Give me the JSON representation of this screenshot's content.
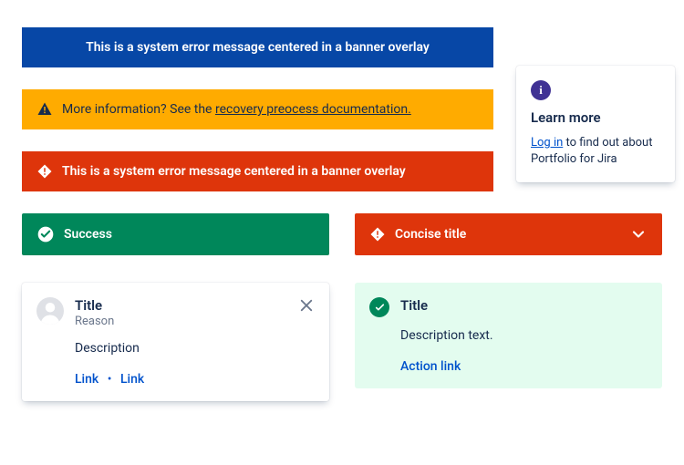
{
  "banners": {
    "blue": {
      "text": "This is a system error message centered in a banner overlay"
    },
    "orange": {
      "prefix": "More information? See the ",
      "link_text": "recovery preocess documentation."
    },
    "red": {
      "text": "This is a system error message centered in a banner overlay"
    }
  },
  "info_card": {
    "title": "Learn more",
    "login_link": "Log in",
    "body_suffix": " to find out about Portfolio for Jira"
  },
  "bar_success": {
    "label": "Success"
  },
  "bar_concise": {
    "label": "Concise title"
  },
  "card_white": {
    "title": "Title",
    "reason": "Reason",
    "description": "Description",
    "link1": "Link",
    "link2": "Link"
  },
  "card_green": {
    "title": "Title",
    "description": "Description text.",
    "action": "Action link"
  }
}
